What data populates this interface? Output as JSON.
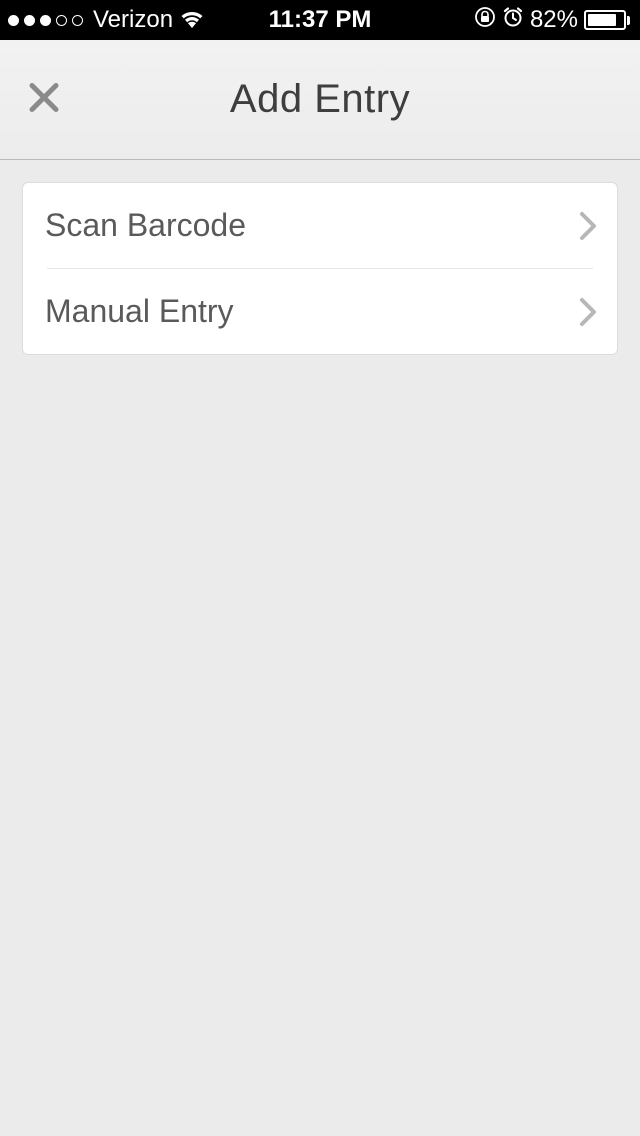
{
  "status_bar": {
    "carrier": "Verizon",
    "time": "11:37 PM",
    "battery_pct": "82%",
    "battery_fill": 82
  },
  "nav": {
    "title": "Add Entry"
  },
  "options": {
    "items": [
      {
        "label": "Scan Barcode",
        "name": "scan-barcode"
      },
      {
        "label": "Manual Entry",
        "name": "manual-entry"
      }
    ]
  }
}
